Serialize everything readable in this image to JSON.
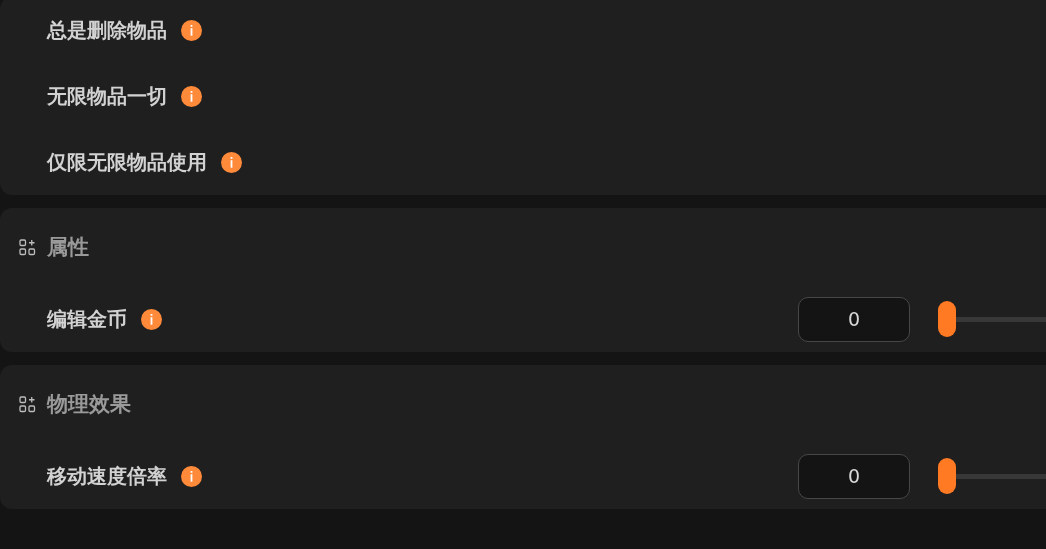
{
  "sections": [
    {
      "rows": [
        {
          "kind": "toggle",
          "label": "总是删除物品"
        },
        {
          "kind": "toggle",
          "label": "无限物品一切"
        },
        {
          "kind": "toggle",
          "label": "仅限无限物品使用"
        }
      ]
    },
    {
      "title": "属性",
      "rows": [
        {
          "kind": "slider",
          "label": "编辑金币",
          "value": "0",
          "level": 0
        }
      ]
    },
    {
      "title": "物理效果",
      "rows": [
        {
          "kind": "slider",
          "label": "移动速度倍率",
          "value": "0",
          "level": 0
        }
      ]
    }
  ]
}
